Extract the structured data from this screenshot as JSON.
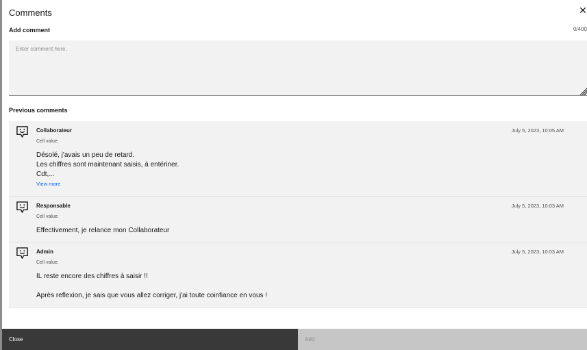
{
  "modal": {
    "title": "Comments",
    "close_icon": "close-icon"
  },
  "add_comment": {
    "label": "Add comment",
    "counter": "0/400",
    "placeholder": "Enter comment here.",
    "value": ""
  },
  "previous": {
    "label": "Previous comments"
  },
  "comments": [
    {
      "icon": "comment-icon",
      "author": "Collaborateur",
      "date": "July 5, 2023, 10:05 AM",
      "cell_value_label": "Cell value:",
      "lines": [
        "Désolé, j'avais un peu de retard.",
        "Les chiffres sont maintenant saisis, à entériner.",
        "Cdt,..."
      ],
      "more_label": "View more"
    },
    {
      "icon": "comment-icon",
      "author": "Responsable",
      "date": "July 5, 2023, 10:03 AM",
      "cell_value_label": "Cell value:",
      "lines": [
        "Effectivement, je relance mon Collaborateur"
      ]
    },
    {
      "icon": "comment-icon",
      "author": "Admin",
      "date": "July 5, 2023, 10:03 AM",
      "cell_value_label": "Cell value:",
      "lines": [
        "IL reste encore des chiffres à saisir !!",
        "",
        "Après reflexion, je sais que vous allez corriger, j'ai toute coinfiance en vous !"
      ]
    }
  ],
  "footer": {
    "close_label": "Close",
    "add_label": "Add"
  },
  "colors": {
    "primary_dark": "#393939",
    "disabled": "#c6c6c6",
    "link": "#0f62fe",
    "field_bg": "#f2f2f2"
  }
}
